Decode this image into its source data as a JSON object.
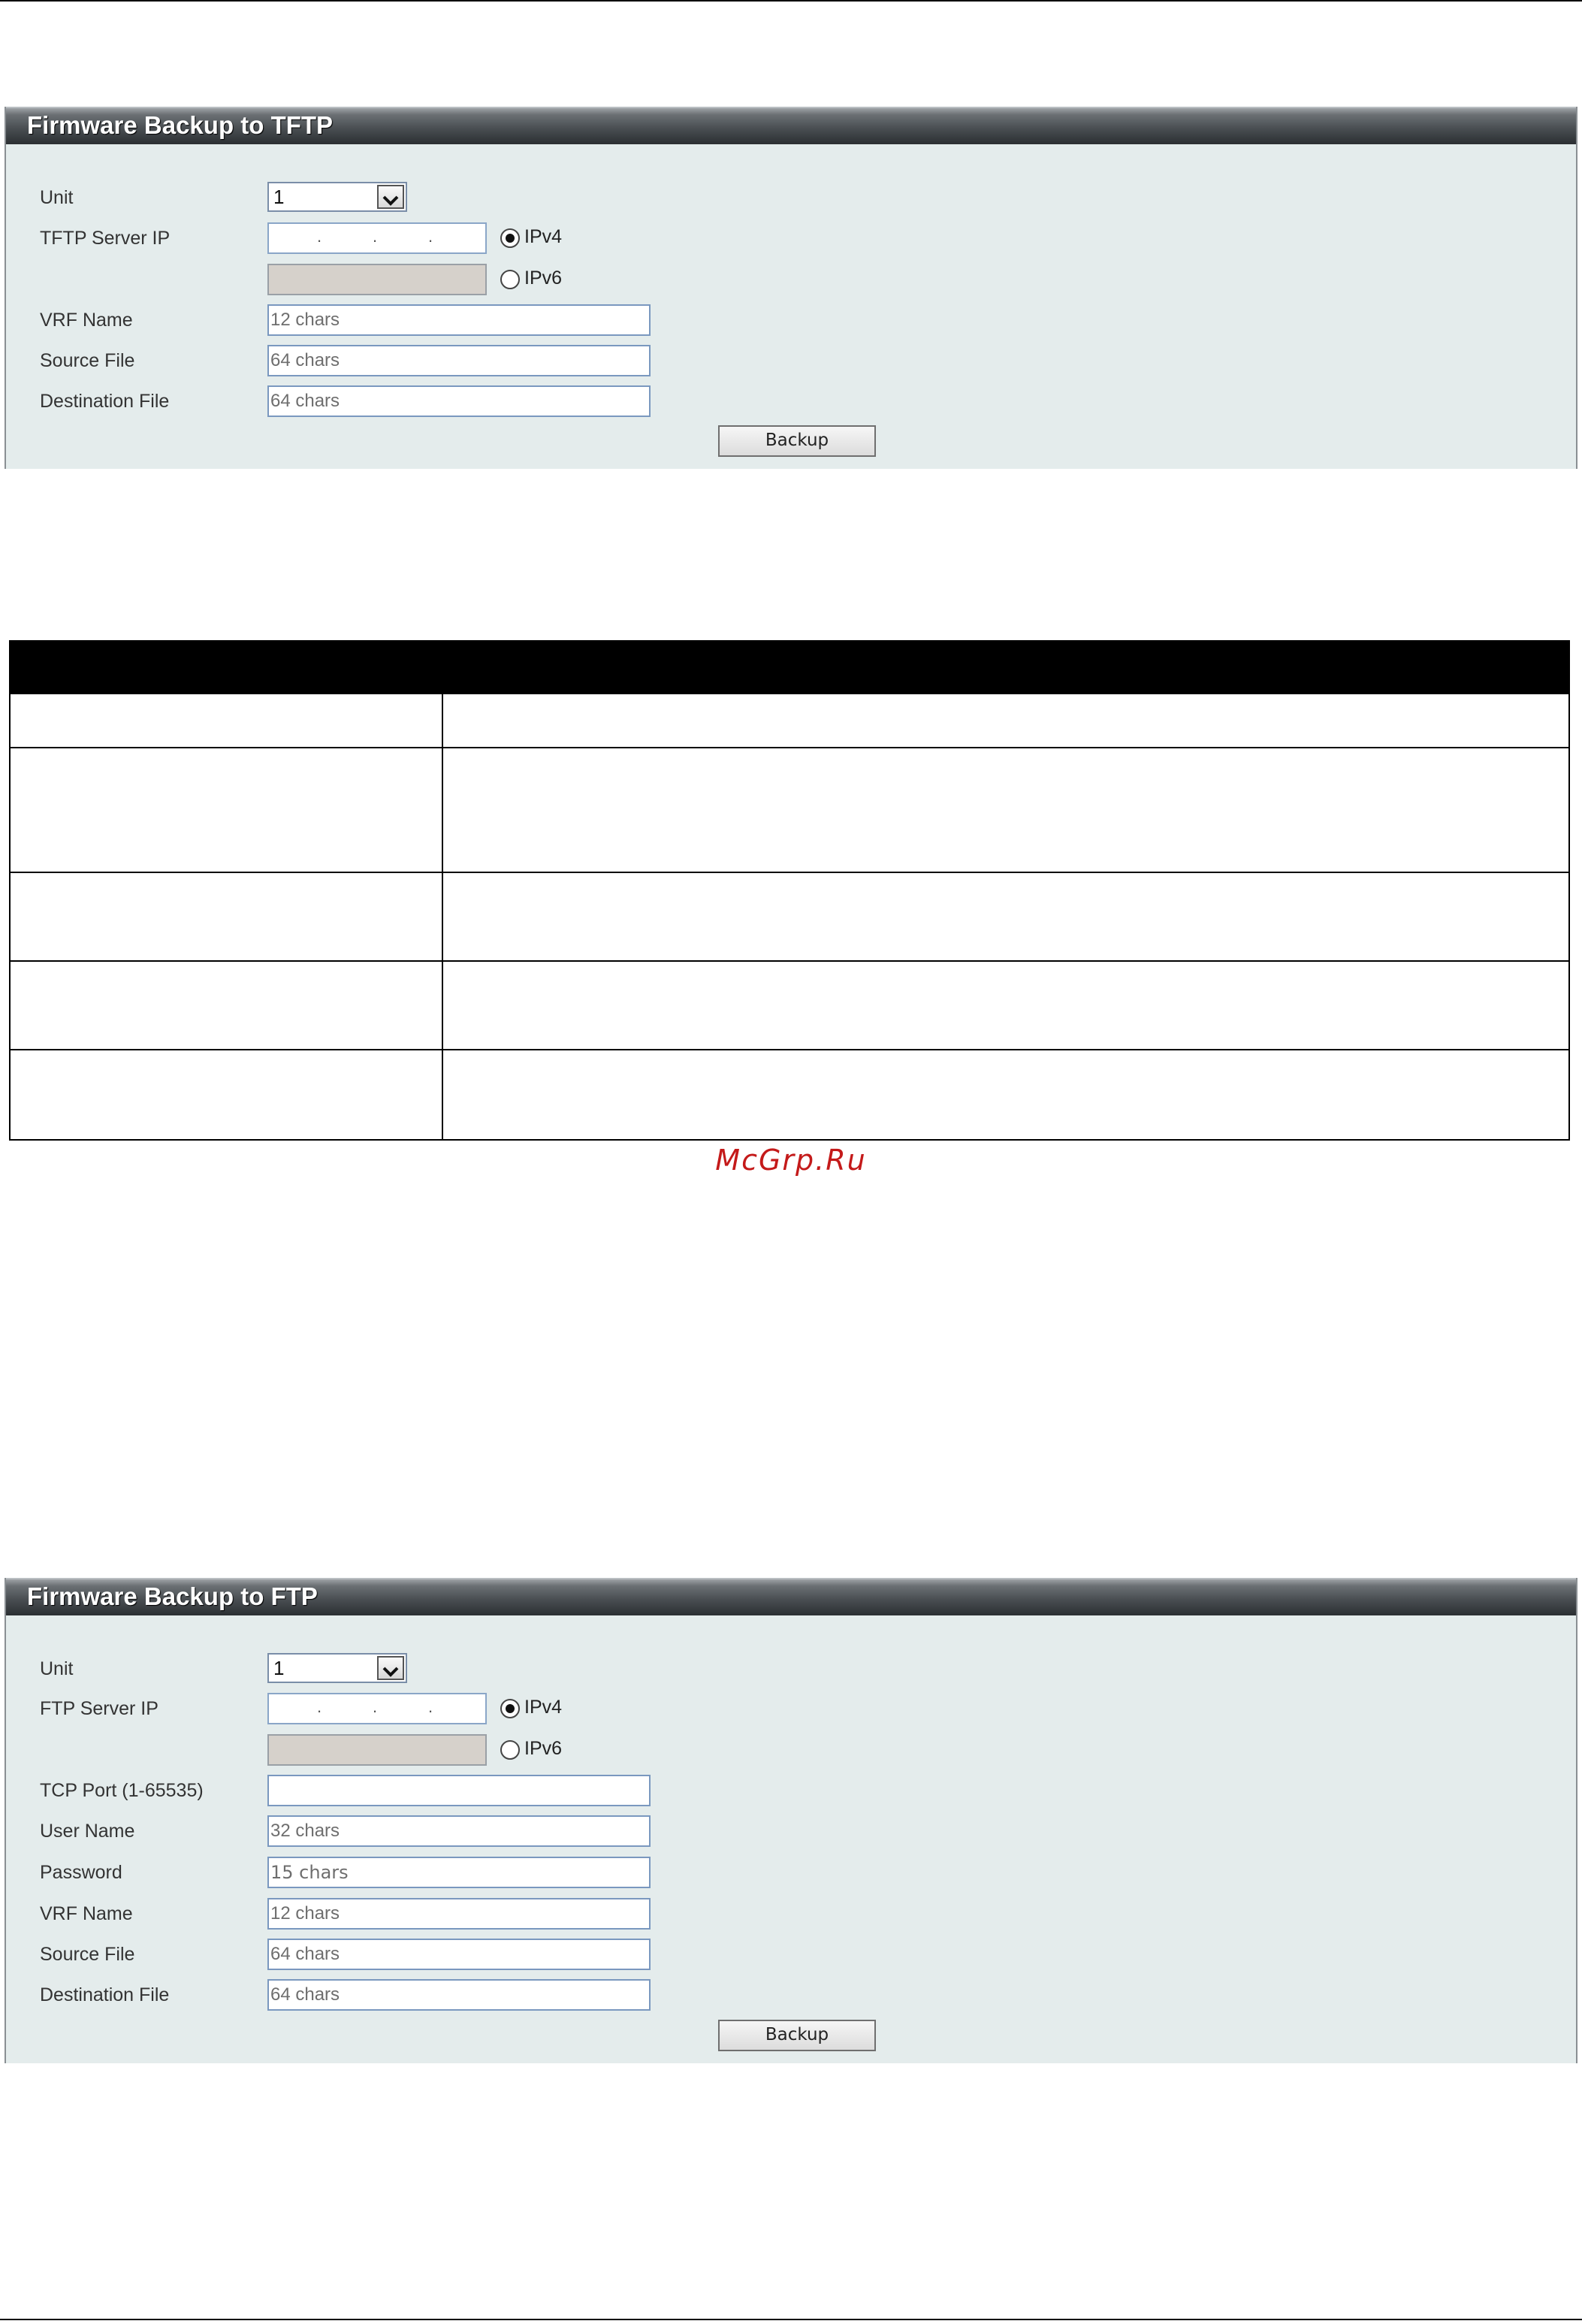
{
  "tftp_panel": {
    "title": "Firmware Backup to TFTP",
    "unit": {
      "label": "Unit",
      "value": "1"
    },
    "server_ip": {
      "label": "TFTP Server IP",
      "ipv4_label": "IPv4",
      "ipv6_label": "IPv6",
      "selected": "IPv4"
    },
    "vrf_name": {
      "label": "VRF Name",
      "placeholder": "12 chars"
    },
    "source_file": {
      "label": "Source File",
      "placeholder": "64 chars"
    },
    "destination_file": {
      "label": "Destination File",
      "placeholder": "64 chars"
    },
    "backup_button": "Backup"
  },
  "ftp_panel": {
    "title": "Firmware Backup to FTP",
    "unit": {
      "label": "Unit",
      "value": "1"
    },
    "server_ip": {
      "label": "FTP Server IP",
      "ipv4_label": "IPv4",
      "ipv6_label": "IPv6",
      "selected": "IPv4"
    },
    "tcp_port": {
      "label": "TCP Port (1-65535)",
      "value": ""
    },
    "user_name": {
      "label": "User Name",
      "placeholder": "32 chars"
    },
    "password": {
      "label": "Password",
      "placeholder": "15 chars"
    },
    "vrf_name": {
      "label": "VRF Name",
      "placeholder": "12 chars"
    },
    "source_file": {
      "label": "Source File",
      "placeholder": "64 chars"
    },
    "destination_file": {
      "label": "Destination File",
      "placeholder": "64 chars"
    },
    "backup_button": "Backup"
  },
  "description_table": {
    "rows": 5
  },
  "watermark": "McGrp.Ru"
}
